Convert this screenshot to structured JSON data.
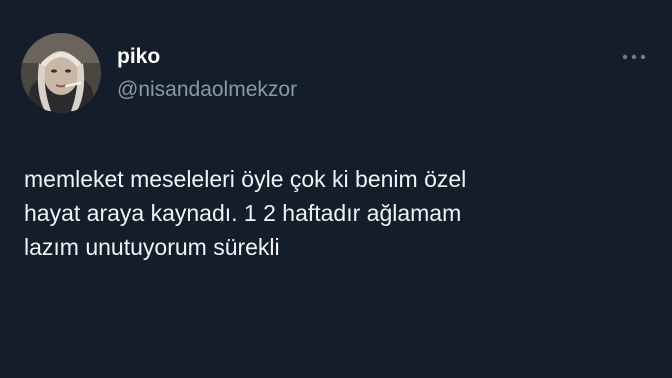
{
  "author": {
    "display_name": "piko",
    "handle": "@nisandaolmekzor",
    "avatar_icon": "profile-photo"
  },
  "tweet": {
    "text": "memleket meseleleri öyle çok ki benim özel\nhayat araya kaynadı. 1 2 haftadır ağlamam\nlazım unutuyorum sürekli"
  },
  "icons": {
    "more": "more-options-icon"
  },
  "colors": {
    "background": "#141d2a",
    "primary_text": "#ffffff",
    "secondary_text": "#8b98a5"
  }
}
